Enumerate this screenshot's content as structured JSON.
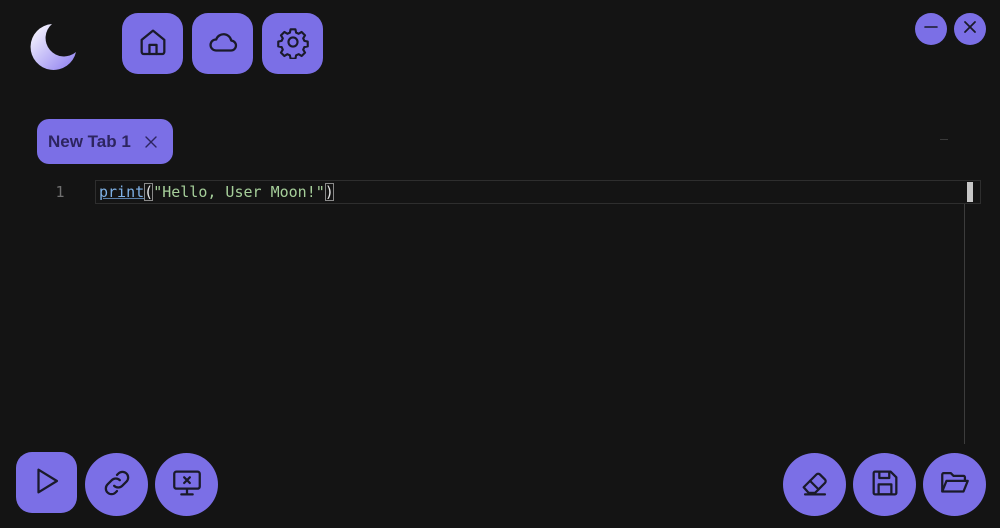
{
  "app": {
    "icons": {
      "logo": "moon-logo",
      "home": "home-icon",
      "cloud": "cloud-icon",
      "settings": "gear-icon",
      "minimize": "minimize-icon",
      "close": "close-icon",
      "run": "play-icon",
      "attach": "link-icon",
      "detach": "monitor-x-icon",
      "clear": "eraser-icon",
      "save": "save-icon",
      "open": "folder-open-icon"
    },
    "colors": {
      "accent": "#7b6fe6",
      "background": "#141414",
      "tab_text": "#2d2560"
    }
  },
  "tabs": [
    {
      "label": "New Tab 1",
      "active": true
    }
  ],
  "editor": {
    "lines": [
      {
        "number": "1",
        "tokens": {
          "fn": "print",
          "open_paren": "(",
          "string": "\"Hello, User Moon!\"",
          "close_paren": ")"
        }
      }
    ]
  }
}
